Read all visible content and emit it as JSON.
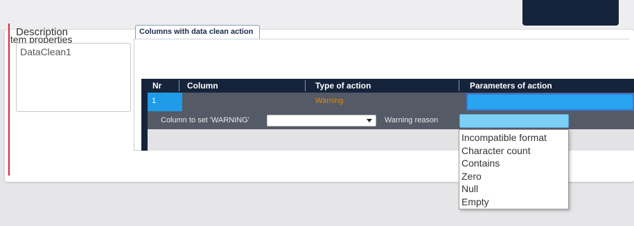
{
  "item_properties": {
    "title": "Item properties",
    "description_label": "Description",
    "description_value": "DataClean1"
  },
  "tab": {
    "label": "Columns with data clean action"
  },
  "grid": {
    "headers": {
      "nr": "Nr",
      "column": "Column",
      "type_of_action": "Type of action",
      "parameters_of_action": "Parameters of action"
    },
    "row": {
      "nr": "1",
      "column": "",
      "type_of_action": "Warning",
      "parameters_of_action": ""
    },
    "subrow": {
      "set_warning_label": "Column to set 'WARNING'",
      "set_warning_value": "",
      "warning_reason_label": "Warning reason",
      "warning_reason_value": ""
    }
  },
  "warning_reason_options": [
    "Incompatible format",
    "Character count",
    "Contains",
    "Zero",
    "Null",
    "Empty"
  ],
  "colors": {
    "header_dark": "#16243b",
    "selected_cell": "#1f9be8",
    "type_warning": "#e08a10",
    "accent_red": "#e0202a"
  }
}
